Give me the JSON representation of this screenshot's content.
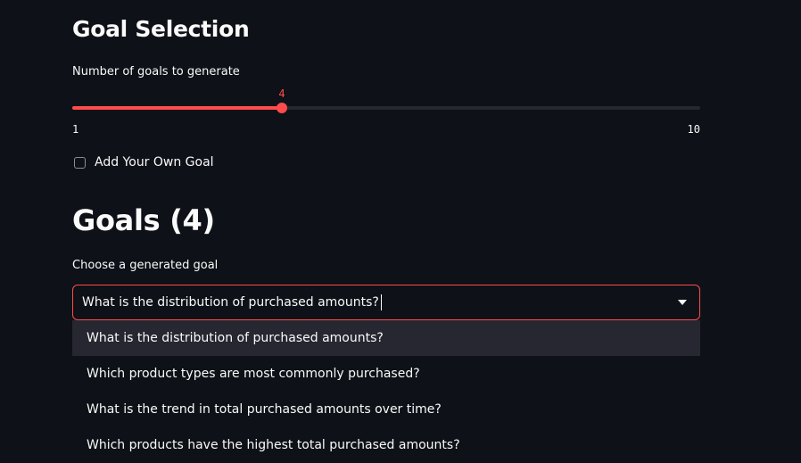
{
  "goal_selection": {
    "title": "Goal Selection",
    "slider": {
      "label": "Number of goals to generate",
      "min": 1,
      "max": 10,
      "value": 4,
      "min_label": "1",
      "max_label": "10",
      "value_label": "4",
      "accent": "#ff4b4b"
    },
    "custom_goal_checkbox": {
      "label": "Add Your Own Goal",
      "checked": false
    }
  },
  "goals": {
    "title": "Goals (4)",
    "select_label": "Choose a generated goal",
    "selected_value": "What is the distribution of purchased amounts?",
    "options": [
      "What is the distribution of purchased amounts?",
      "Which product types are most commonly purchased?",
      "What is the trend in total purchased amounts over time?",
      "Which products have the highest total purchased amounts?"
    ],
    "highlighted_index": 0,
    "dropdown_icon": "chevron-down-icon"
  },
  "colors": {
    "background": "#0e1117",
    "accent": "#ff4b4b",
    "text": "#fafafa",
    "option_highlight": "#262730"
  }
}
